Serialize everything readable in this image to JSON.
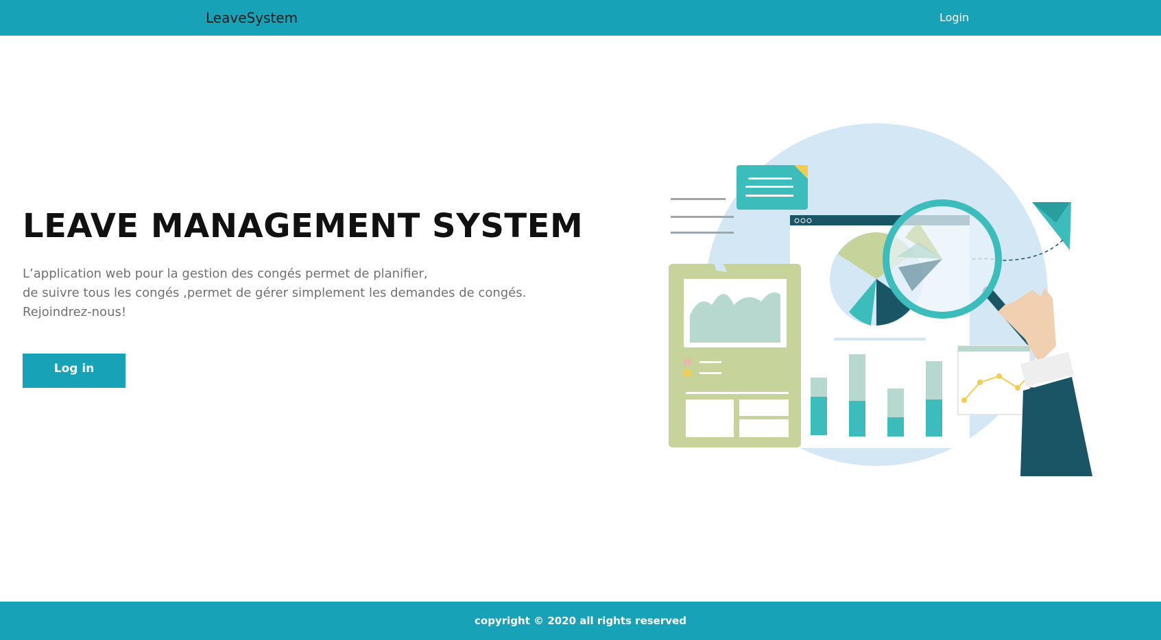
{
  "navbar": {
    "brand": "LeaveSystem",
    "login_label": "Login",
    "color": "#18a2b8"
  },
  "hero": {
    "title": "LEAVE MANAGEMENT SYSTEM",
    "description_lines": [
      "L’application web pour la gestion des congés permet de planifier,",
      "de suivre tous les congés ,permet de gérer simplement les demandes de congés.",
      "Rejoindrez-nous!"
    ],
    "button_label": "Log in",
    "illustration": "data-analytics-illustration"
  },
  "footer": {
    "text": "copyright © 2020 all rights reserved"
  },
  "colors": {
    "primary": "#18a2b8",
    "title": "#111111",
    "text": "#707070"
  }
}
